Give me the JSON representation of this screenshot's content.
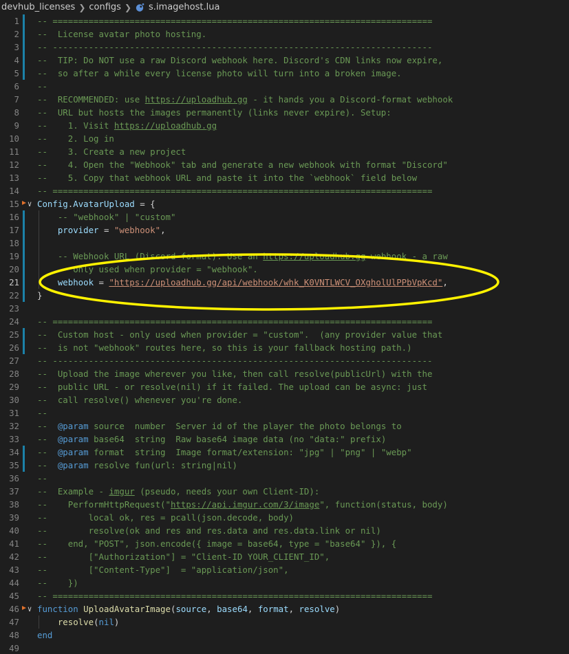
{
  "breadcrumb": {
    "items": [
      "devhub_licenses",
      "configs",
      "s.imagehost.lua"
    ]
  },
  "editor": {
    "active_line": 21,
    "lines": [
      {
        "n": "1",
        "ch": "added",
        "fold": "",
        "segs": [
          {
            "t": "-- ==========================================================================",
            "c": "c"
          }
        ]
      },
      {
        "n": "2",
        "ch": "added",
        "fold": "",
        "segs": [
          {
            "t": "--  License avatar photo hosting.",
            "c": "c"
          }
        ]
      },
      {
        "n": "3",
        "ch": "added",
        "fold": "",
        "segs": [
          {
            "t": "-- --------------------------------------------------------------------------",
            "c": "c"
          }
        ]
      },
      {
        "n": "4",
        "ch": "added",
        "fold": "",
        "segs": [
          {
            "t": "--  TIP: Do NOT use a raw Discord webhook here. Discord's CDN links now expire,",
            "c": "c"
          }
        ]
      },
      {
        "n": "5",
        "ch": "added",
        "fold": "",
        "segs": [
          {
            "t": "--  so after a while every license photo will turn into a broken image.",
            "c": "c"
          }
        ]
      },
      {
        "n": "6",
        "ch": "",
        "fold": "",
        "segs": [
          {
            "t": "--",
            "c": "c"
          }
        ]
      },
      {
        "n": "7",
        "ch": "",
        "fold": "",
        "segs": [
          {
            "t": "--  RECOMMENDED: use ",
            "c": "c"
          },
          {
            "t": "https://uploadhub.gg",
            "c": "c u"
          },
          {
            "t": " - it hands you a Discord-format webhook",
            "c": "c"
          }
        ]
      },
      {
        "n": "8",
        "ch": "",
        "fold": "",
        "segs": [
          {
            "t": "--  URL but hosts the images permanently (links never expire). Setup:",
            "c": "c"
          }
        ]
      },
      {
        "n": "9",
        "ch": "",
        "fold": "",
        "segs": [
          {
            "t": "--    1. Visit ",
            "c": "c"
          },
          {
            "t": "https://uploadhub.gg",
            "c": "c u"
          }
        ]
      },
      {
        "n": "10",
        "ch": "",
        "fold": "",
        "segs": [
          {
            "t": "--    2. Log in",
            "c": "c"
          }
        ]
      },
      {
        "n": "11",
        "ch": "",
        "fold": "",
        "segs": [
          {
            "t": "--    3. Create a new project",
            "c": "c"
          }
        ]
      },
      {
        "n": "12",
        "ch": "",
        "fold": "",
        "segs": [
          {
            "t": "--    4. Open the \"Webhook\" tab and generate a new webhook with format \"Discord\"",
            "c": "c"
          }
        ]
      },
      {
        "n": "13",
        "ch": "",
        "fold": "",
        "segs": [
          {
            "t": "--    5. Copy that webhook URL and paste it into the `webhook` field below",
            "c": "c"
          }
        ]
      },
      {
        "n": "14",
        "ch": "",
        "fold": "",
        "segs": [
          {
            "t": "-- ==========================================================================",
            "c": "c"
          }
        ]
      },
      {
        "n": "15",
        "ch": "",
        "fold": "v",
        "segs": [
          {
            "t": "Config",
            "c": "v"
          },
          {
            "t": ".",
            "c": "p"
          },
          {
            "t": "AvatarUpload",
            "c": "v"
          },
          {
            "t": " = {",
            "c": "p"
          }
        ]
      },
      {
        "n": "16",
        "ch": "added",
        "fold": "",
        "segs": [
          {
            "t": "    -- \"webhook\" | \"custom\"",
            "c": "c"
          }
        ]
      },
      {
        "n": "17",
        "ch": "added",
        "fold": "",
        "segs": [
          {
            "t": "    ",
            "c": "p"
          },
          {
            "t": "provider",
            "c": "v"
          },
          {
            "t": " = ",
            "c": "p"
          },
          {
            "t": "\"webhook\"",
            "c": "s"
          },
          {
            "t": ",",
            "c": "p"
          }
        ]
      },
      {
        "n": "18",
        "ch": "added",
        "fold": "",
        "segs": [
          {
            "t": "",
            "c": "p"
          }
        ]
      },
      {
        "n": "19",
        "ch": "added",
        "fold": "",
        "segs": [
          {
            "t": "    -- Webhook URL (Discord format). Use an ",
            "c": "c"
          },
          {
            "t": "https://uploadhub.gg",
            "c": "c u"
          },
          {
            "t": " webhook - a raw",
            "c": "c"
          }
        ]
      },
      {
        "n": "20",
        "ch": "added",
        "fold": "",
        "segs": [
          {
            "t": "    -- only used when provider = \"webhook\".",
            "c": "c"
          }
        ]
      },
      {
        "n": "21",
        "ch": "added",
        "fold": "",
        "segs": [
          {
            "t": "    ",
            "c": "p"
          },
          {
            "t": "webhook",
            "c": "v"
          },
          {
            "t": " = ",
            "c": "p"
          },
          {
            "t": "\"https://uploadhub.gg/api/webhook/whk_K0VNTLWCV_OXgholUlPPbVpKcd\"",
            "c": "s u"
          },
          {
            "t": ",",
            "c": "p"
          }
        ]
      },
      {
        "n": "22",
        "ch": "added",
        "fold": "",
        "segs": [
          {
            "t": "}",
            "c": "p"
          }
        ]
      },
      {
        "n": "23",
        "ch": "",
        "fold": "",
        "segs": [
          {
            "t": "",
            "c": "p"
          }
        ]
      },
      {
        "n": "24",
        "ch": "",
        "fold": "",
        "segs": [
          {
            "t": "-- ==========================================================================",
            "c": "c"
          }
        ]
      },
      {
        "n": "25",
        "ch": "added",
        "fold": "",
        "segs": [
          {
            "t": "--  Custom host - only used when provider = \"custom\".  (any provider value that",
            "c": "c"
          }
        ]
      },
      {
        "n": "26",
        "ch": "added",
        "fold": "",
        "segs": [
          {
            "t": "--  is not \"webhook\" routes here, so this is your fallback hosting path.)",
            "c": "c"
          }
        ]
      },
      {
        "n": "27",
        "ch": "",
        "fold": "",
        "segs": [
          {
            "t": "-- --------------------------------------------------------------------------",
            "c": "c"
          }
        ]
      },
      {
        "n": "28",
        "ch": "",
        "fold": "",
        "segs": [
          {
            "t": "--  Upload the image wherever you like, then call resolve(publicUrl) with the",
            "c": "c"
          }
        ]
      },
      {
        "n": "29",
        "ch": "",
        "fold": "",
        "segs": [
          {
            "t": "--  public URL - or resolve(nil) if it failed. The upload can be async: just",
            "c": "c"
          }
        ]
      },
      {
        "n": "30",
        "ch": "",
        "fold": "",
        "segs": [
          {
            "t": "--  call resolve() whenever you're done.",
            "c": "c"
          }
        ]
      },
      {
        "n": "31",
        "ch": "",
        "fold": "",
        "segs": [
          {
            "t": "--",
            "c": "c"
          }
        ]
      },
      {
        "n": "32",
        "ch": "",
        "fold": "",
        "segs": [
          {
            "t": "--  ",
            "c": "c"
          },
          {
            "t": "@param",
            "c": "kw"
          },
          {
            "t": " source  number  Server id of the player the photo belongs to",
            "c": "c"
          }
        ]
      },
      {
        "n": "33",
        "ch": "",
        "fold": "",
        "segs": [
          {
            "t": "--  ",
            "c": "c"
          },
          {
            "t": "@param",
            "c": "kw"
          },
          {
            "t": " base64  string  Raw base64 image data (no \"data:\" prefix)",
            "c": "c"
          }
        ]
      },
      {
        "n": "34",
        "ch": "added",
        "fold": "",
        "segs": [
          {
            "t": "--  ",
            "c": "c"
          },
          {
            "t": "@param",
            "c": "kw"
          },
          {
            "t": " format  string  Image format/extension: \"jpg\" | \"png\" | \"webp\"",
            "c": "c"
          }
        ]
      },
      {
        "n": "35",
        "ch": "added",
        "fold": "",
        "segs": [
          {
            "t": "--  ",
            "c": "c"
          },
          {
            "t": "@param",
            "c": "kw"
          },
          {
            "t": " resolve fun(url: string|nil)",
            "c": "c"
          }
        ]
      },
      {
        "n": "36",
        "ch": "",
        "fold": "",
        "segs": [
          {
            "t": "--",
            "c": "c"
          }
        ]
      },
      {
        "n": "37",
        "ch": "",
        "fold": "",
        "segs": [
          {
            "t": "--  Example - ",
            "c": "c"
          },
          {
            "t": "imgur",
            "c": "c u"
          },
          {
            "t": " (pseudo, needs your own Client-ID):",
            "c": "c"
          }
        ]
      },
      {
        "n": "38",
        "ch": "",
        "fold": "",
        "segs": [
          {
            "t": "--    PerformHttpRequest(\"",
            "c": "c"
          },
          {
            "t": "https://api.imgur.com/3/image",
            "c": "c u"
          },
          {
            "t": "\", function(status, body)",
            "c": "c"
          }
        ]
      },
      {
        "n": "39",
        "ch": "",
        "fold": "",
        "segs": [
          {
            "t": "--        local ok, res = pcall(json.decode, body)",
            "c": "c"
          }
        ]
      },
      {
        "n": "40",
        "ch": "",
        "fold": "",
        "segs": [
          {
            "t": "--        resolve(ok and res and res.data and res.data.link or nil)",
            "c": "c"
          }
        ]
      },
      {
        "n": "41",
        "ch": "",
        "fold": "",
        "segs": [
          {
            "t": "--    end, \"POST\", json.encode({ image = base64, type = \"base64\" }), {",
            "c": "c"
          }
        ]
      },
      {
        "n": "42",
        "ch": "",
        "fold": "",
        "segs": [
          {
            "t": "--        [\"Authorization\"] = \"Client-ID YOUR_CLIENT_ID\",",
            "c": "c"
          }
        ]
      },
      {
        "n": "43",
        "ch": "",
        "fold": "",
        "segs": [
          {
            "t": "--        [\"Content-Type\"]  = \"application/json\",",
            "c": "c"
          }
        ]
      },
      {
        "n": "44",
        "ch": "",
        "fold": "",
        "segs": [
          {
            "t": "--    })",
            "c": "c"
          }
        ]
      },
      {
        "n": "45",
        "ch": "",
        "fold": "",
        "segs": [
          {
            "t": "-- ==========================================================================",
            "c": "c"
          }
        ]
      },
      {
        "n": "46",
        "ch": "",
        "fold": "v",
        "segs": [
          {
            "t": "function",
            "c": "kw"
          },
          {
            "t": " ",
            "c": "p"
          },
          {
            "t": "UploadAvatarImage",
            "c": "f"
          },
          {
            "t": "(",
            "c": "p"
          },
          {
            "t": "source",
            "c": "v"
          },
          {
            "t": ", ",
            "c": "p"
          },
          {
            "t": "base64",
            "c": "v"
          },
          {
            "t": ", ",
            "c": "p"
          },
          {
            "t": "format",
            "c": "v"
          },
          {
            "t": ", ",
            "c": "p"
          },
          {
            "t": "resolve",
            "c": "v"
          },
          {
            "t": ")",
            "c": "p"
          }
        ]
      },
      {
        "n": "47",
        "ch": "",
        "fold": "",
        "segs": [
          {
            "t": "    ",
            "c": "p"
          },
          {
            "t": "resolve",
            "c": "f"
          },
          {
            "t": "(",
            "c": "p"
          },
          {
            "t": "nil",
            "c": "kw"
          },
          {
            "t": ")",
            "c": "p"
          }
        ]
      },
      {
        "n": "48",
        "ch": "",
        "fold": "",
        "segs": [
          {
            "t": "end",
            "c": "kw"
          }
        ]
      },
      {
        "n": "49",
        "ch": "",
        "fold": "",
        "segs": [
          {
            "t": "",
            "c": "p"
          }
        ]
      }
    ]
  },
  "annotation": {
    "shape": "ellipse",
    "color": "#fff200",
    "encloses_line": 21
  },
  "colors": {
    "background": "#1e1e1e",
    "comment": "#6a9955",
    "string": "#ce9178",
    "variable": "#9cdcfe",
    "keyword": "#569cd6",
    "function": "#dcdcaa",
    "gutter_added": "#1b81a8"
  }
}
